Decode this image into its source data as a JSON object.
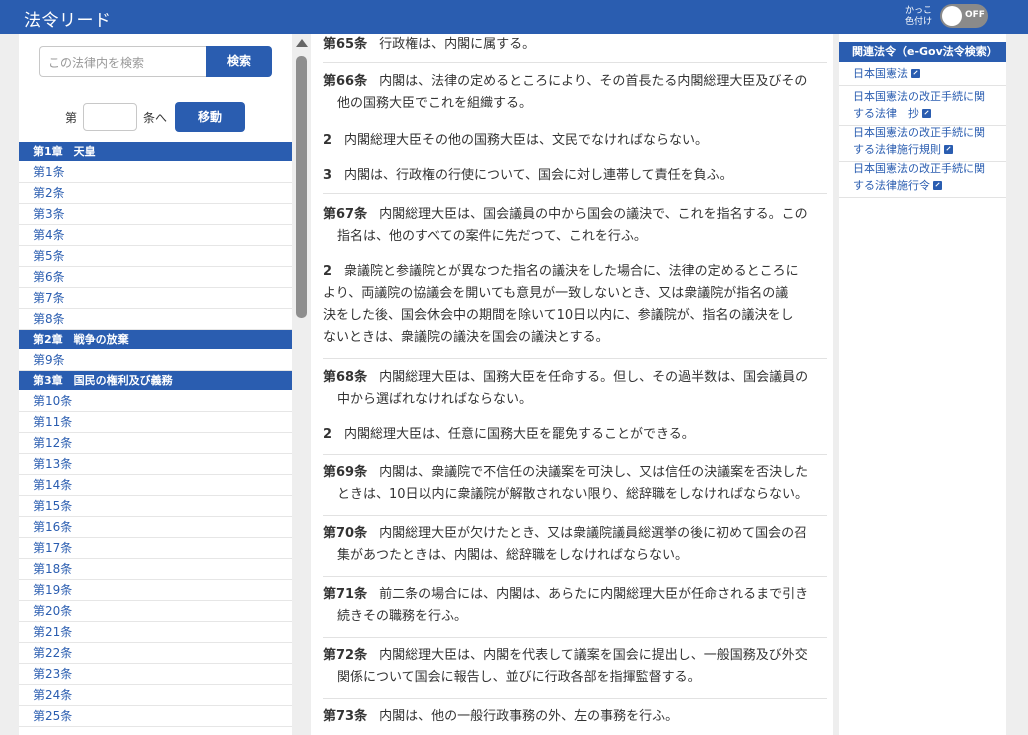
{
  "header": {
    "logo": "法令リード",
    "toggle_label_1": "かっこ",
    "toggle_label_2": "色付け",
    "toggle_state": "OFF"
  },
  "sidebar": {
    "search_placeholder": "この法律内を検索",
    "search_button": "検索",
    "jump_prefix": "第",
    "jump_suffix": "条へ",
    "jump_button": "移動",
    "toc": [
      {
        "type": "chapter",
        "label": "第1章　天皇"
      },
      {
        "type": "item",
        "label": "第1条"
      },
      {
        "type": "item",
        "label": "第2条"
      },
      {
        "type": "item",
        "label": "第3条"
      },
      {
        "type": "item",
        "label": "第4条"
      },
      {
        "type": "item",
        "label": "第5条"
      },
      {
        "type": "item",
        "label": "第6条"
      },
      {
        "type": "item",
        "label": "第7条"
      },
      {
        "type": "item",
        "label": "第8条"
      },
      {
        "type": "chapter",
        "label": "第2章　戦争の放棄"
      },
      {
        "type": "item",
        "label": "第9条"
      },
      {
        "type": "chapter",
        "label": "第3章　国民の権利及び義務"
      },
      {
        "type": "item",
        "label": "第10条"
      },
      {
        "type": "item",
        "label": "第11条"
      },
      {
        "type": "item",
        "label": "第12条"
      },
      {
        "type": "item",
        "label": "第13条"
      },
      {
        "type": "item",
        "label": "第14条"
      },
      {
        "type": "item",
        "label": "第15条"
      },
      {
        "type": "item",
        "label": "第16条"
      },
      {
        "type": "item",
        "label": "第17条"
      },
      {
        "type": "item",
        "label": "第18条"
      },
      {
        "type": "item",
        "label": "第19条"
      },
      {
        "type": "item",
        "label": "第20条"
      },
      {
        "type": "item",
        "label": "第21条"
      },
      {
        "type": "item",
        "label": "第22条"
      },
      {
        "type": "item",
        "label": "第23条"
      },
      {
        "type": "item",
        "label": "第24条"
      },
      {
        "type": "item",
        "label": "第25条"
      }
    ]
  },
  "content": {
    "a65": {
      "num": "第65条",
      "text": "行政権は、内閣に属する。"
    },
    "a66": {
      "num": "第66条",
      "line1": "内閣は、法律の定めるところにより、その首長たる内閣総理大臣及びその",
      "line2": "他の国務大臣でこれを組織する。"
    },
    "a66p2": {
      "num": "2",
      "text": "内閣総理大臣その他の国務大臣は、文民でなければならない。"
    },
    "a66p3": {
      "num": "3",
      "text": "内閣は、行政権の行使について、国会に対し連帯して責任を負ふ。"
    },
    "a67": {
      "num": "第67条",
      "line1": "内閣総理大臣は、国会議員の中から国会の議決で、これを指名する。この",
      "line2": "指名は、他のすべての案件に先だつて、これを行ふ。"
    },
    "a67p2": {
      "num": "2",
      "line1": "衆議院と参議院とが異なつた指名の議決をした場合に、法律の定めるところに",
      "line2": "より、両議院の協議会を開いても意見が一致しないとき、又は衆議院が指名の議",
      "line3": "決をした後、国会休会中の期間を除いて10日以内に、参議院が、指名の議決をし",
      "line4": "ないときは、衆議院の議決を国会の議決とする。"
    },
    "a68": {
      "num": "第68条",
      "line1": "内閣総理大臣は、国務大臣を任命する。但し、その過半数は、国会議員の",
      "line2": "中から選ばれなければならない。"
    },
    "a68p2": {
      "num": "2",
      "text": "内閣総理大臣は、任意に国務大臣を罷免することができる。"
    },
    "a69": {
      "num": "第69条",
      "line1": "内閣は、衆議院で不信任の決議案を可決し、又は信任の決議案を否決した",
      "line2": "ときは、10日以内に衆議院が解散されない限り、総辞職をしなければならない。"
    },
    "a70": {
      "num": "第70条",
      "line1": "内閣総理大臣が欠けたとき、又は衆議院議員総選挙の後に初めて国会の召",
      "line2": "集があつたときは、内閣は、総辞職をしなければならない。"
    },
    "a71": {
      "num": "第71条",
      "line1": "前二条の場合には、内閣は、あらたに内閣総理大臣が任命されるまで引き",
      "line2": "続きその職務を行ふ。"
    },
    "a72": {
      "num": "第72条",
      "line1": "内閣総理大臣は、内閣を代表して議案を国会に提出し、一般国務及び外交",
      "line2": "関係について国会に報告し、並びに行政各部を指揮監督する。"
    },
    "a73": {
      "num": "第73条",
      "text": "内閣は、他の一般行政事務の外、左の事務を行ふ。"
    }
  },
  "related": {
    "title": "関連法令（e-Gov法令検索）",
    "items": [
      {
        "line1": "日本国憲法",
        "line2": ""
      },
      {
        "line1": "日本国憲法の改正手続に関",
        "line2": "する法律　抄"
      },
      {
        "line1": "日本国憲法の改正手続に関",
        "line2": "する法律施行規則"
      },
      {
        "line1": "日本国憲法の改正手続に関",
        "line2": "する法律施行令"
      }
    ]
  }
}
